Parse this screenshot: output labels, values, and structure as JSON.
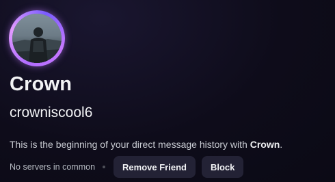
{
  "profile": {
    "display_name": "Crown",
    "username": "crowniscool6",
    "avatar_icon": "avatar-photo-icon",
    "ring_color": "#b06cff"
  },
  "intro": {
    "prefix": "This is the beginning of your direct message history with ",
    "name": "Crown",
    "suffix": "."
  },
  "mutual": {
    "servers_text": "No servers in common"
  },
  "actions": {
    "remove_friend_label": "Remove Friend",
    "block_label": "Block"
  },
  "colors": {
    "background": "#0e0c1a",
    "button_bg": "#232235",
    "text_primary": "#f2f3f5",
    "text_muted": "#b5bac1"
  }
}
